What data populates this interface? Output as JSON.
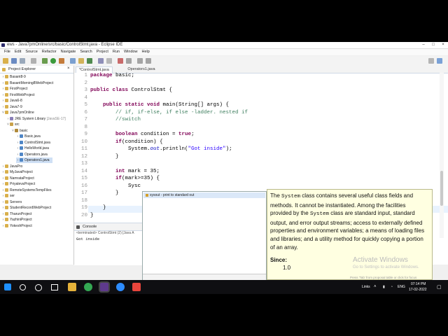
{
  "window": {
    "title": "ews - Java7pmOnline/src/basic/ControlStmt.java - Eclipse IDE"
  },
  "menu": [
    "File",
    "Edit",
    "Source",
    "Refactor",
    "Navigate",
    "Search",
    "Project",
    "Run",
    "Window",
    "Help"
  ],
  "project_explorer": {
    "tab": "Project Explorer",
    "items": [
      {
        "label": "Basant8-9",
        "level": 0,
        "exp": ">",
        "icon": "folder"
      },
      {
        "label": "BasantMorning8WebProject",
        "level": 0,
        "exp": ">",
        "icon": "folder"
      },
      {
        "label": "FirstProject",
        "level": 0,
        "exp": ">",
        "icon": "folder"
      },
      {
        "label": "FirstWebProject",
        "level": 0,
        "exp": ">",
        "icon": "folder"
      },
      {
        "label": "Java6-8",
        "level": 0,
        "exp": ">",
        "icon": "folder"
      },
      {
        "label": "Java7-9",
        "level": 0,
        "exp": ">",
        "icon": "folder"
      },
      {
        "label": "Java7pmOnline",
        "level": 0,
        "exp": "v",
        "icon": "folder"
      },
      {
        "label": "JRE System Library",
        "suffix": " [JavaSE-17]",
        "level": 1,
        "exp": ">",
        "icon": "lib"
      },
      {
        "label": "src",
        "level": 1,
        "exp": "v",
        "icon": "src"
      },
      {
        "label": "basic",
        "level": 2,
        "exp": "v",
        "icon": "pkg"
      },
      {
        "label": "Basic.java",
        "level": 3,
        "exp": ">",
        "icon": "java"
      },
      {
        "label": "ControlStmt.java",
        "level": 3,
        "exp": ">",
        "icon": "java"
      },
      {
        "label": "HelloWorld.java",
        "level": 3,
        "exp": ">",
        "icon": "java"
      },
      {
        "label": "Operators.java",
        "level": 3,
        "exp": ">",
        "icon": "java"
      },
      {
        "label": "Operators1.java",
        "level": 3,
        "exp": ">",
        "icon": "java",
        "selected": true
      },
      {
        "label": "JavaPro",
        "level": 0,
        "exp": ">",
        "icon": "folder"
      },
      {
        "label": "MyJavaProject",
        "level": 0,
        "exp": ">",
        "icon": "folder"
      },
      {
        "label": "NamrataProject",
        "level": 0,
        "exp": ">",
        "icon": "folder"
      },
      {
        "label": "PriyalevaProject",
        "level": 0,
        "exp": ">",
        "icon": "folder"
      },
      {
        "label": "RemoteSystemsTempFiles",
        "level": 0,
        "exp": ">",
        "icon": "folder"
      },
      {
        "label": "ser",
        "level": 0,
        "exp": ">",
        "icon": "folder"
      },
      {
        "label": "Servers",
        "level": 0,
        "exp": ">",
        "icon": "folder"
      },
      {
        "label": "StudentRecordWebProject",
        "level": 0,
        "exp": ">",
        "icon": "folder"
      },
      {
        "label": "TharunProject",
        "level": 0,
        "exp": ">",
        "icon": "folder"
      },
      {
        "label": "YazhiniProject",
        "level": 0,
        "exp": ">",
        "icon": "folder"
      },
      {
        "label": "YokeshProject",
        "level": 0,
        "exp": ">",
        "icon": "folder"
      }
    ]
  },
  "editor": {
    "tabs": [
      {
        "label": "*ControlStmt.java",
        "active": true
      },
      {
        "label": "Operators1.java",
        "active": false
      }
    ],
    "lines": [
      {
        "n": "1",
        "t": "<span class=\"kw\">package</span> basic;"
      },
      {
        "n": "2",
        "t": ""
      },
      {
        "n": "3",
        "t": "<span class=\"kw\">public class</span> ControlStmt {"
      },
      {
        "n": "4",
        "t": ""
      },
      {
        "n": "5",
        "t": "    <span class=\"kw\">public static void</span> main(String[] args) {"
      },
      {
        "n": "6",
        "t": "        <span class=\"cm\">// if, if-else, if else -ladder. nested if</span>"
      },
      {
        "n": "7",
        "t": "        <span class=\"cm\">//switch</span>"
      },
      {
        "n": "8",
        "t": ""
      },
      {
        "n": "9",
        "t": "        <span class=\"kw\">boolean</span> condition = <span class=\"kw\">true</span>;"
      },
      {
        "n": "10",
        "t": "        <span class=\"kw\">if</span>(condition) {"
      },
      {
        "n": "11",
        "t": "            System.<span class=\"fi\">out</span>.println(<span class=\"st\">\"Got inside\"</span>);"
      },
      {
        "n": "12",
        "t": "        }"
      },
      {
        "n": "13",
        "t": ""
      },
      {
        "n": "14",
        "t": "        <span class=\"kw\">int</span> mark = 35;"
      },
      {
        "n": "15",
        "t": "        <span class=\"kw\">if</span>(mark&gt;=35) {"
      },
      {
        "n": "16",
        "t": "            Sysc"
      },
      {
        "n": "17",
        "t": "        }"
      },
      {
        "n": "18",
        "t": ""
      },
      {
        "n": "19",
        "t": "    }"
      },
      {
        "n": "20",
        "t": "}"
      }
    ]
  },
  "console": {
    "tab": "Console",
    "terminated": "<terminated> ControlStmt (2) [Java A",
    "output": "Got inside"
  },
  "content_assist": {
    "suggestion": "sysout - print to standard out"
  },
  "javadoc": {
    "p1": "The",
    "m1": "System",
    "p2": "class contains several useful class fields and methods. It cannot be instantiated. Among the facilities provided by the",
    "m2": "System",
    "p3": "class are standard input, standard output, and error output streams; access to externally defined properties and environment variables; a means of loading files and libraries; and a utility method for quickly copying a portion of an array.",
    "since_label": "Since:",
    "since_value": "1.0",
    "hint": "Press 'Tab' from proposal table or click for focus"
  },
  "watermark": {
    "line1": "Activate Windows",
    "line2": "Go to Settings to activate Windows."
  },
  "taskbar": {
    "links": "Links",
    "lang": "ENG",
    "time": "07:14 PM",
    "date": "17-02-2022"
  },
  "colors": {
    "keyword": "#7f0055",
    "comment": "#3f7f5f",
    "string": "#2a00ff",
    "selection": "#cfe0f5"
  }
}
